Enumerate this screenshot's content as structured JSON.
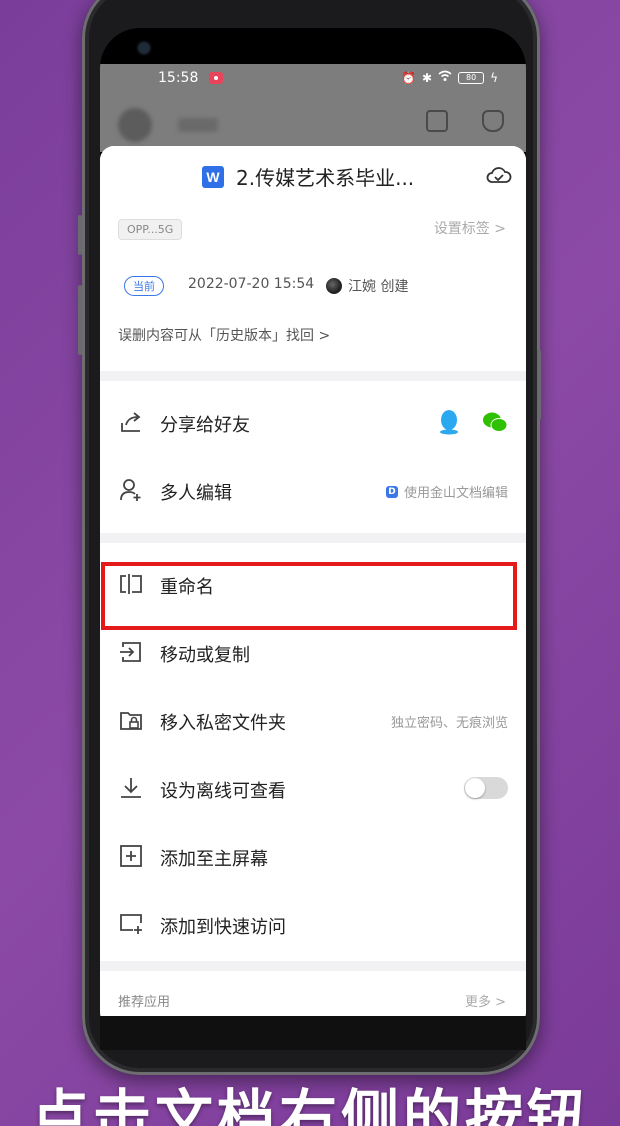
{
  "status": {
    "time": "15:58",
    "battery": "80"
  },
  "doc": {
    "title": "2.传媒艺术系毕业...",
    "app_icon": "W",
    "network_tag": "OPP...5G",
    "set_tag": "设置标签 >"
  },
  "meta": {
    "current_badge": "当前",
    "date": "2022-07-20 15:54",
    "creator": "江婉 创建",
    "history_hint": "误删内容可从「历史版本」找回 >"
  },
  "menu": {
    "share": {
      "label": "分享给好友"
    },
    "multi_edit": {
      "label": "多人编辑",
      "right": "使用金山文档编辑"
    },
    "rename": {
      "label": "重命名"
    },
    "move_copy": {
      "label": "移动或复制"
    },
    "private": {
      "label": "移入私密文件夹",
      "right": "独立密码、无痕浏览"
    },
    "offline": {
      "label": "设为离线可查看"
    },
    "home": {
      "label": "添加至主屏幕"
    },
    "quick": {
      "label": "添加到快速访问"
    }
  },
  "recommend": {
    "label": "推荐应用",
    "more": "更多 >"
  },
  "caption": "点击文档右侧的按钮",
  "colors": {
    "highlight": "#e41a1a",
    "accent": "#3b78e7",
    "qq": "#2aa9f0",
    "wechat": "#2dc100"
  }
}
